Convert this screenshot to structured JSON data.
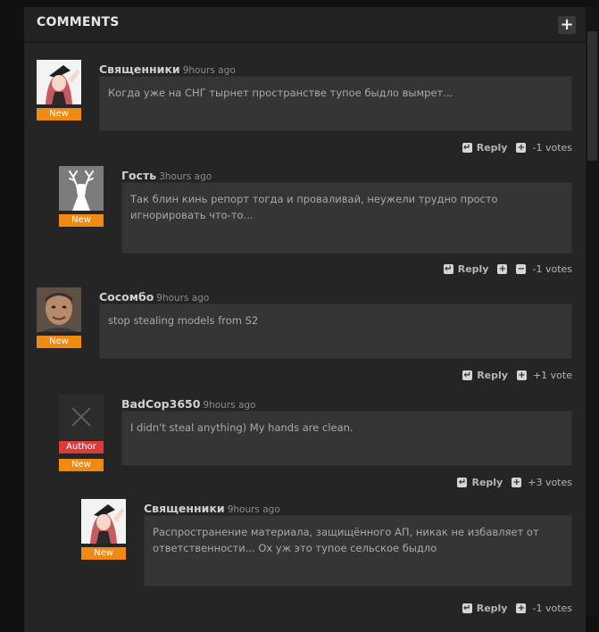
{
  "panel": {
    "title": "COMMENTS",
    "add_symbol": "+"
  },
  "labels": {
    "reply": "Reply",
    "reply_icon": "↵",
    "plus": "+",
    "minus": "−"
  },
  "comments": [
    {
      "author": "Священники",
      "time": "9hours ago",
      "text": "Когда уже на СНГ тырнет пространстве тупое быдло вымрет...",
      "badges": [
        "New"
      ],
      "votes": "-1 votes",
      "avatar": "anime-girl-avatar"
    },
    {
      "author": "Гость",
      "time": "3hours ago",
      "text": "Так блин кинь репорт тогда и проваливай, неужели трудно просто игнорировать что-то...",
      "badges": [
        "New"
      ],
      "votes": "-1 votes",
      "avatar": "deer-avatar"
    },
    {
      "author": "Сосомбо",
      "time": "9hours ago",
      "text": "stop stealing models from S2",
      "badges": [
        "New"
      ],
      "votes": "+1 vote",
      "avatar": "man-face-avatar"
    },
    {
      "author": "BadCop3650",
      "time": "9hours ago",
      "text": "I didn't steal anything) My hands are clean.",
      "badges": [
        "Author",
        "New"
      ],
      "votes": "+3 votes",
      "avatar": "empty-x-avatar"
    },
    {
      "author": "Священники",
      "time": "9hours ago",
      "text": "Распространение материала, защищённого АП, никак не избавляет от ответственности... Ох уж это тупое сельское быдло",
      "badges": [
        "New"
      ],
      "votes": "-1 votes",
      "avatar": "anime-girl-avatar"
    }
  ]
}
